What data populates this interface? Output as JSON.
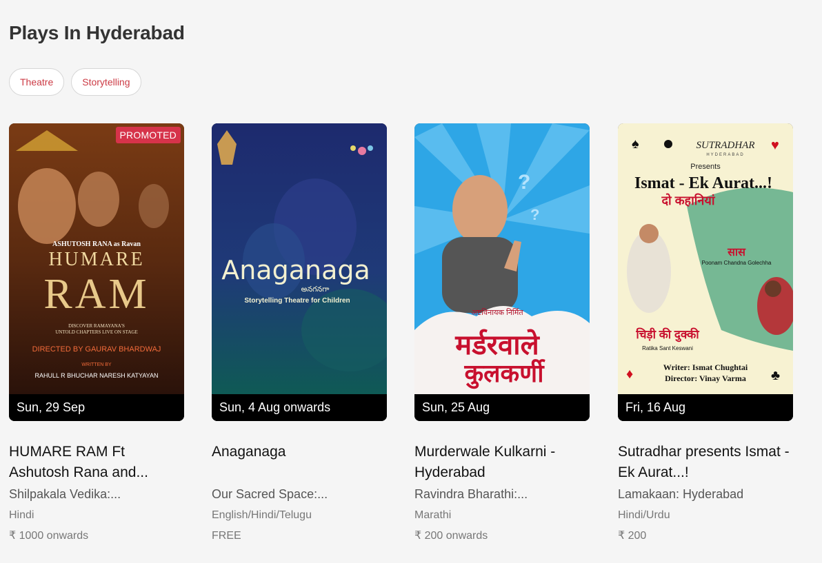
{
  "page": {
    "title": "Plays In Hyderabad"
  },
  "filters": [
    "Theatre",
    "Storytelling"
  ],
  "colors": {
    "accent": "#cc3a44",
    "promoted_badge": "#d6334a",
    "background": "#f5f5f5"
  },
  "cards": [
    {
      "title": "HUMARE RAM Ft Ashutosh Rana and...",
      "venue": "Shilpakala Vedika:...",
      "language": "Hindi",
      "price": "₹ 1000 onwards",
      "date": "Sun, 29 Sep",
      "badge": "PROMOTED",
      "poster": {
        "line1": "ASHUTOSH RANA as Ravan",
        "line2": "HUMARE",
        "line3": "RAM",
        "line4": "DISCOVER RAMAYANA'S",
        "line5": "UNTOLD CHAPTERS LIVE ON STAGE",
        "line6": "DIRECTED BY GAURAV BHARDWAJ",
        "line7": "WRITTEN BY",
        "line8": "RAHULL R BHUCHAR  NARESH KATYAYAN"
      }
    },
    {
      "title": "Anaganaga",
      "venue": "Our Sacred Space:...",
      "language": "English/Hindi/Telugu",
      "price": "FREE",
      "date": "Sun, 4 Aug onwards",
      "poster": {
        "line1": "Anaganaga",
        "line2": "అనగనగా",
        "line3": "Storytelling Theatre for Children"
      }
    },
    {
      "title": "Murderwale Kulkarni - Hyderabad",
      "venue": "Ravindra Bharathi:...",
      "language": "Marathi",
      "price": "₹ 200 onwards",
      "date": "Sun, 25 Aug",
      "poster": {
        "line1": "अष्टविनायक निर्मित",
        "line2": "मर्डरवाले",
        "line3": "कुलकर्णी"
      }
    },
    {
      "title": "Sutradhar presents Ismat - Ek Aurat...!",
      "venue": "Lamakaan: Hyderabad",
      "language": "Hindi/Urdu",
      "price": "₹ 200",
      "date": "Fri, 16 Aug",
      "poster": {
        "line1": "SUTRADHAR",
        "line2": "HYDERABAD",
        "line3": "Presents",
        "line4": "Ismat - Ek Aurat...!",
        "line5": "दो कहानियां",
        "line6": "सास",
        "line7": "Poonam Chandna Golechha",
        "line8": "चिड़ी की दुक्की",
        "line9": "Ratika Sant Keswani",
        "line10": "Writer: Ismat Chughtai",
        "line11": "Director: Vinay Varma"
      }
    }
  ]
}
